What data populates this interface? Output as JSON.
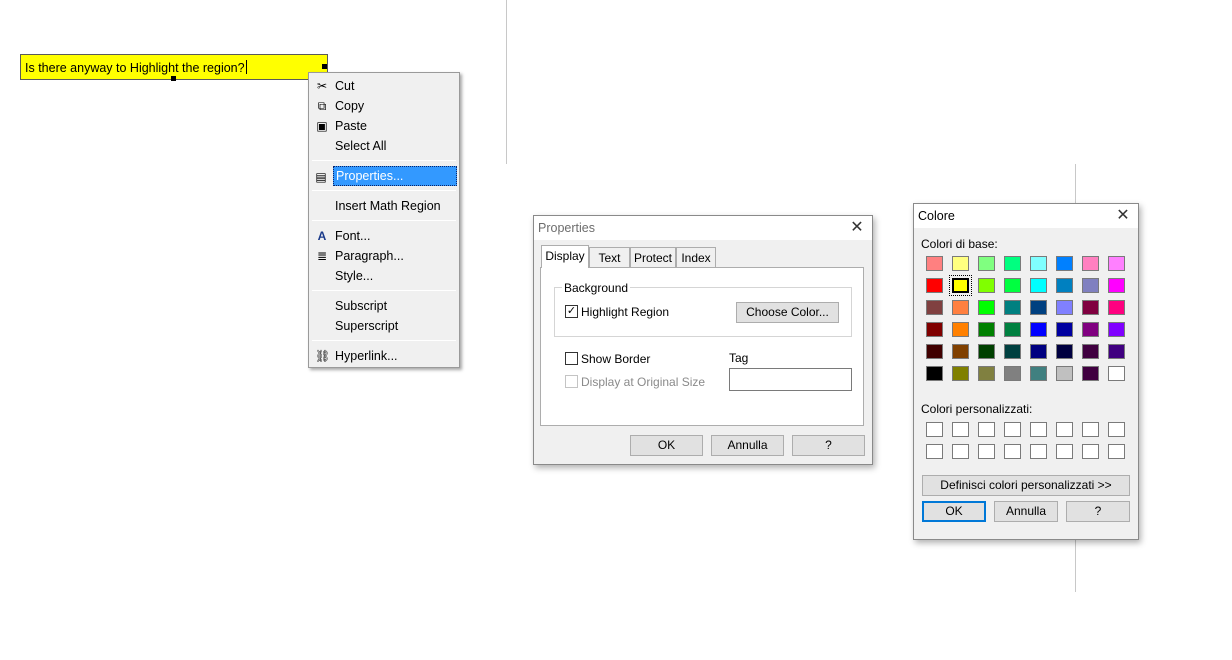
{
  "document": {
    "region_text": "Is there anyway to Highlight the region?"
  },
  "context_menu": {
    "items": [
      {
        "label": "Cut",
        "icon": "scissors-icon"
      },
      {
        "label": "Copy",
        "icon": "copy-icon"
      },
      {
        "label": "Paste",
        "icon": "paste-icon"
      },
      {
        "label": "Select All",
        "icon": ""
      },
      {
        "label": "Properties...",
        "icon": "properties-icon"
      },
      {
        "label": "Insert Math Region",
        "icon": ""
      },
      {
        "label": "Font...",
        "icon": "font-icon"
      },
      {
        "label": "Paragraph...",
        "icon": "paragraph-icon"
      },
      {
        "label": "Style...",
        "icon": ""
      },
      {
        "label": "Subscript",
        "icon": ""
      },
      {
        "label": "Superscript",
        "icon": ""
      },
      {
        "label": "Hyperlink...",
        "icon": "hyperlink-icon"
      }
    ],
    "highlighted": "Properties..."
  },
  "properties_dialog": {
    "title": "Properties",
    "tabs": [
      "Display",
      "Text",
      "Protect",
      "Index"
    ],
    "selected_tab": "Display",
    "background_group": "Background",
    "highlight_region_label": "Highlight Region",
    "highlight_region_checked": true,
    "choose_color_button": "Choose Color...",
    "show_border_label": "Show Border",
    "show_border_checked": false,
    "display_original_label": "Display at Original Size",
    "display_original_checked": false,
    "tag_label": "Tag",
    "tag_value": "",
    "ok_button": "OK",
    "cancel_button": "Annulla",
    "help_button": "?"
  },
  "color_dialog": {
    "title": "Colore",
    "basic_colors_label": "Colori di base:",
    "basic_colors": [
      [
        "#ff8080",
        "#ffff80",
        "#80ff80",
        "#00ff80",
        "#80ffff",
        "#0080ff",
        "#ff80c0",
        "#ff80ff"
      ],
      [
        "#ff0000",
        "#ffff00",
        "#80ff00",
        "#00ff40",
        "#00ffff",
        "#0080c0",
        "#8080c0",
        "#ff00ff"
      ],
      [
        "#804040",
        "#ff8040",
        "#00ff00",
        "#008080",
        "#004080",
        "#8080ff",
        "#800040",
        "#ff0080"
      ],
      [
        "#800000",
        "#ff8000",
        "#008000",
        "#008040",
        "#0000ff",
        "#0000a0",
        "#800080",
        "#8000ff"
      ],
      [
        "#400000",
        "#804000",
        "#004000",
        "#004040",
        "#000080",
        "#000040",
        "#400040",
        "#400080"
      ],
      [
        "#000000",
        "#808000",
        "#808040",
        "#808080",
        "#408080",
        "#c0c0c0",
        "#400040",
        "#ffffff"
      ]
    ],
    "selected_color": "#ffff00",
    "custom_colors_label": "Colori personalizzati:",
    "define_button": "Definisci colori personalizzati >>",
    "ok_button": "OK",
    "cancel_button": "Annulla",
    "help_button": "?"
  }
}
